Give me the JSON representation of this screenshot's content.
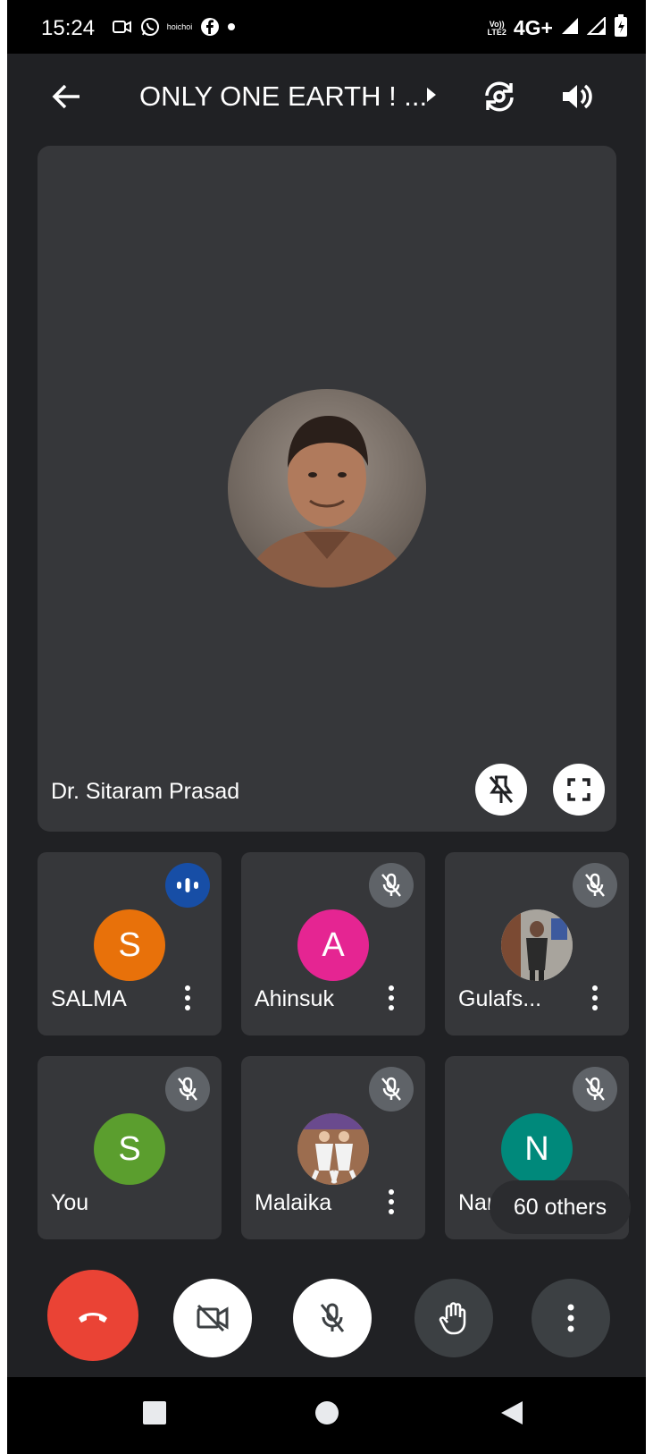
{
  "status_bar": {
    "time": "15:24",
    "notification_icons": [
      "video-call-icon",
      "whatsapp-icon",
      "hoichoi-icon",
      "facebook-icon",
      "dot-icon"
    ],
    "hoichoi_text": "hoichoi",
    "volte": "Vo)) LTE2",
    "network": "4G+"
  },
  "header": {
    "title": "ONLY ONE EARTH ! ...",
    "back_icon": "arrow-back-icon",
    "switch_camera_icon": "switch-camera-icon",
    "speaker_icon": "speaker-icon"
  },
  "main_tile": {
    "name": "Dr. Sitaram Prasad",
    "pin_icon": "unpin-icon",
    "fullscreen_icon": "fullscreen-icon"
  },
  "participants": [
    {
      "name": "SALMA",
      "initial": "S",
      "color": "#e8710a",
      "status": "speaking"
    },
    {
      "name": "Ahinsuk",
      "initial": "A",
      "color": "#e52592",
      "status": "muted"
    },
    {
      "name": "Gulafs...",
      "initial": "",
      "color": "#5f6368",
      "status": "muted"
    },
    {
      "name": "You",
      "initial": "S",
      "color": "#5b9e2e",
      "status": "muted"
    },
    {
      "name": "Malaika",
      "initial": "",
      "color": "#8d6e63",
      "status": "muted"
    },
    {
      "name": "Nargis",
      "initial": "N",
      "color": "#00897b",
      "status": "muted"
    }
  ],
  "others_chip": "60 others",
  "controls": {
    "end_call": "end-call-icon",
    "camera": "camera-off-icon",
    "mic": "mic-off-icon",
    "raise_hand": "raise-hand-icon",
    "more": "more-options-icon",
    "end_call_color": "#ea4335"
  },
  "navbar": [
    "recents-icon",
    "home-icon",
    "back-icon"
  ]
}
